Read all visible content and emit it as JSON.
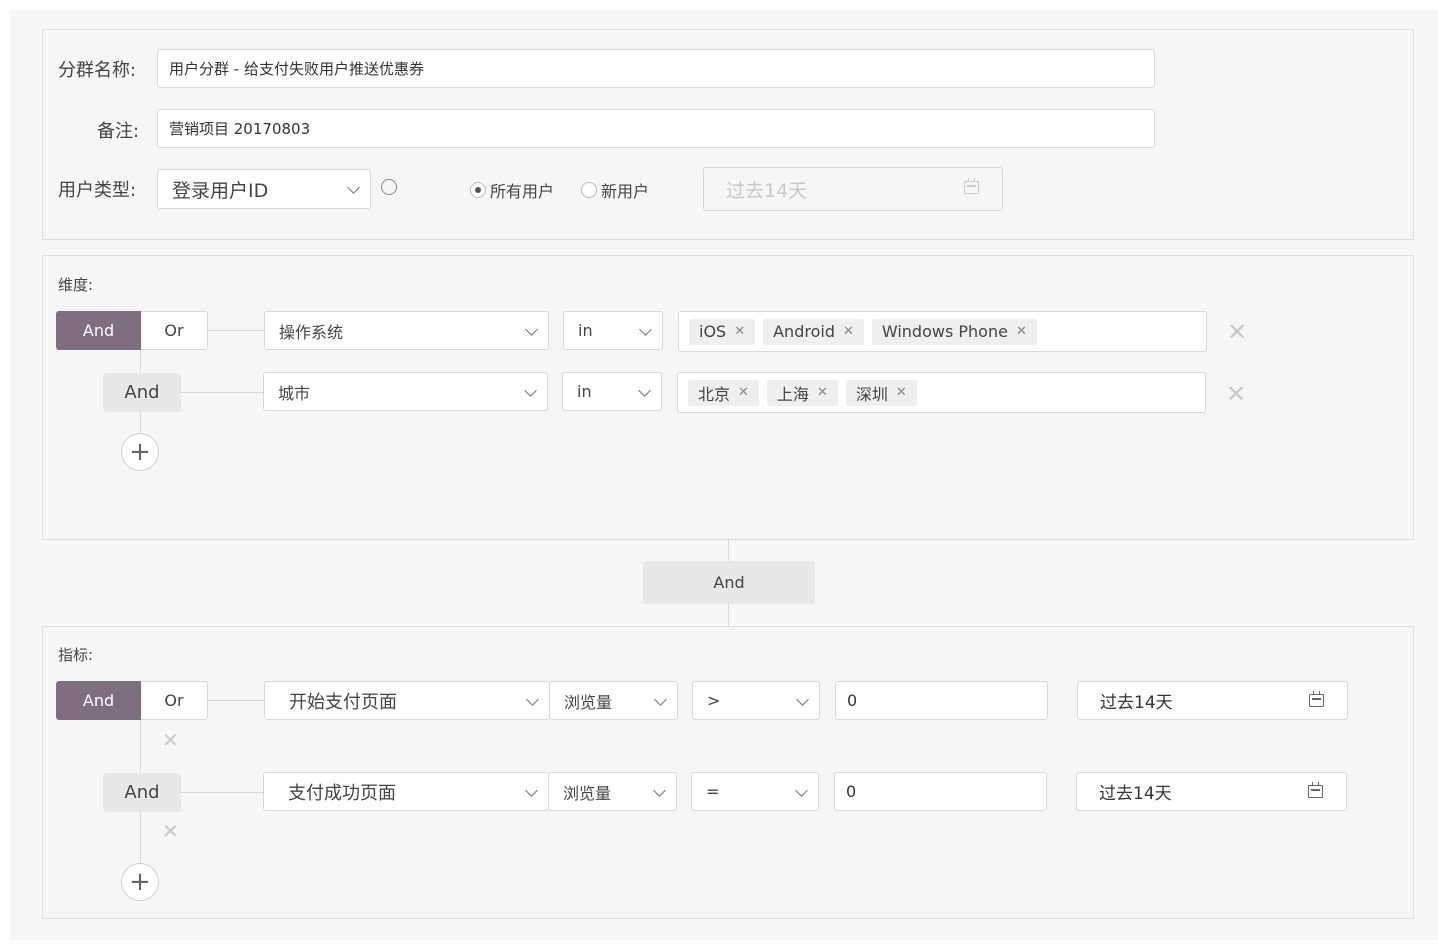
{
  "basic": {
    "name_label": "分群名称:",
    "name_value": "用户分群 - 给支付失败用户推送优惠券",
    "note_label": "备注:",
    "note_value": "营销项目 20170803",
    "user_type_label": "用户类型:",
    "user_type_value": "登录用户ID",
    "radio_all": "所有用户",
    "radio_new": "新用户",
    "radio_selected": "所有用户",
    "date_placeholder": "过去14天"
  },
  "dimension": {
    "title": "维度:",
    "and_label": "And",
    "or_label": "Or",
    "rows": [
      {
        "logic": "And",
        "field": "操作系统",
        "op": "in",
        "tags": [
          "iOS",
          "Android",
          "Windows Phone"
        ]
      },
      {
        "logic": "And",
        "field": "城市",
        "op": "in",
        "tags": [
          "北京",
          "上海",
          "深圳"
        ]
      }
    ]
  },
  "connector": {
    "label": "And"
  },
  "metric": {
    "title": "指标:",
    "and_label": "And",
    "or_label": "Or",
    "rows": [
      {
        "logic": "And",
        "page": "开始支付页面",
        "measure": "浏览量",
        "op": ">",
        "value": "0",
        "date": "过去14天"
      },
      {
        "logic": "And",
        "page": "支付成功页面",
        "measure": "浏览量",
        "op": "=",
        "value": "0",
        "date": "过去14天"
      }
    ]
  },
  "icons": {
    "remove": "close-icon",
    "add": "plus-icon",
    "calendar": "calendar-icon",
    "info": "info-icon"
  },
  "colors": {
    "and_active_bg": "#7e6e80",
    "panel_bg": "#f6f6f6",
    "border": "#dddddd"
  }
}
